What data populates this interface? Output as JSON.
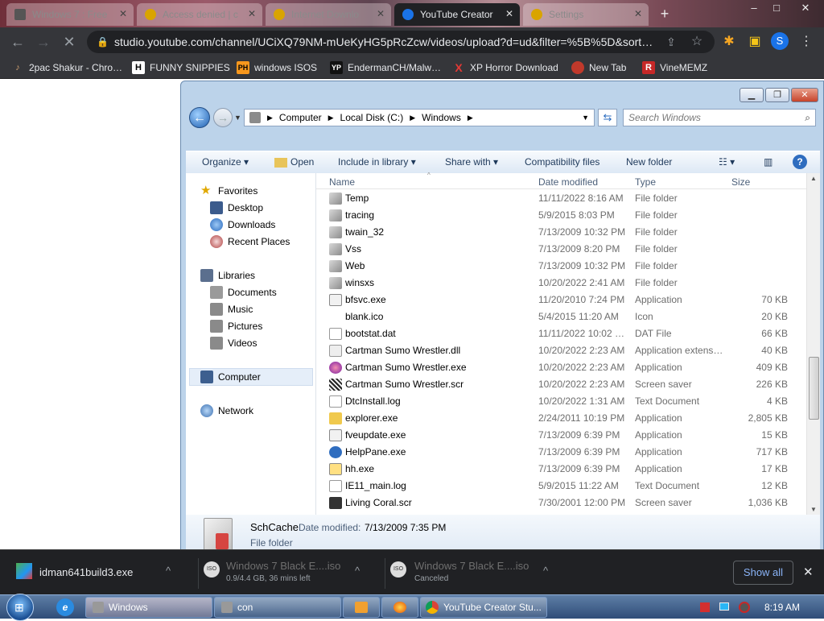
{
  "browser": {
    "tabs": [
      {
        "title": "Windows 7 : Free",
        "icon_color": "#6b6b6b"
      },
      {
        "title": "Access denied | c",
        "icon_color": "#f4b400"
      },
      {
        "title": "Internet Downlo",
        "icon_color": "#f4b400"
      },
      {
        "title": "YouTube Creator",
        "icon_color": "#1a73e8"
      },
      {
        "title": "Settings",
        "icon_color": "#f4b400"
      }
    ],
    "new_tab": "+",
    "window_controls": [
      "–",
      "□",
      "✕"
    ],
    "url": "studio.youtube.com/channel/UCiXQ79NM-mUeKyHG5pRcZcw/videos/upload?d=ud&filter=%5B%5D&sort…",
    "profile_initial": "S",
    "bookmarks": [
      {
        "label": "2pac Shakur - Chro…",
        "icon": "guitar-icon"
      },
      {
        "label": "FUNNY SNIPPIES",
        "icon": "H"
      },
      {
        "label": "windows ISOS",
        "icon": "PH"
      },
      {
        "label": "EndermanCH/Malw…",
        "icon": "YP"
      },
      {
        "label": "XP Horror Download",
        "icon": "X"
      },
      {
        "label": "New Tab",
        "icon": "globe-icon"
      },
      {
        "label": "VineMEMZ",
        "icon": "R"
      }
    ]
  },
  "explorer": {
    "breadcrumb": [
      "Computer",
      "Local Disk (C:)",
      "Windows"
    ],
    "search_placeholder": "Search Windows",
    "toolbar": {
      "organize": "Organize",
      "open": "Open",
      "include": "Include in library",
      "share": "Share with",
      "compat": "Compatibility files",
      "new_folder": "New folder"
    },
    "nav": {
      "favorites": "Favorites",
      "desktop": "Desktop",
      "downloads": "Downloads",
      "recent": "Recent Places",
      "libraries": "Libraries",
      "documents": "Documents",
      "music": "Music",
      "pictures": "Pictures",
      "videos": "Videos",
      "computer": "Computer",
      "network": "Network"
    },
    "columns": {
      "name": "Name",
      "date": "Date modified",
      "type": "Type",
      "size": "Size"
    },
    "files": [
      {
        "name": "Temp",
        "date": "11/11/2022 8:16 AM",
        "type": "File folder",
        "size": "",
        "kind": "folder"
      },
      {
        "name": "tracing",
        "date": "5/9/2015 8:03 PM",
        "type": "File folder",
        "size": "",
        "kind": "folder"
      },
      {
        "name": "twain_32",
        "date": "7/13/2009 10:32 PM",
        "type": "File folder",
        "size": "",
        "kind": "folder"
      },
      {
        "name": "Vss",
        "date": "7/13/2009 8:20 PM",
        "type": "File folder",
        "size": "",
        "kind": "folder"
      },
      {
        "name": "Web",
        "date": "7/13/2009 10:32 PM",
        "type": "File folder",
        "size": "",
        "kind": "folder"
      },
      {
        "name": "winsxs",
        "date": "10/20/2022 2:41 AM",
        "type": "File folder",
        "size": "",
        "kind": "folder"
      },
      {
        "name": "bfsvc.exe",
        "date": "11/20/2010 7:24 PM",
        "type": "Application",
        "size": "70 KB",
        "kind": "app"
      },
      {
        "name": "blank.ico",
        "date": "5/4/2015 11:20 AM",
        "type": "Icon",
        "size": "20 KB",
        "kind": "blank"
      },
      {
        "name": "bootstat.dat",
        "date": "11/11/2022 10:02 …",
        "type": "DAT File",
        "size": "66 KB",
        "kind": "file"
      },
      {
        "name": "Cartman Sumo Wrestler.dll",
        "date": "10/20/2022 2:23 AM",
        "type": "Application extens…",
        "size": "40 KB",
        "kind": "dll"
      },
      {
        "name": "Cartman Sumo Wrestler.exe",
        "date": "10/20/2022 2:23 AM",
        "type": "Application",
        "size": "409 KB",
        "kind": "exe"
      },
      {
        "name": "Cartman Sumo Wrestler.scr",
        "date": "10/20/2022 2:23 AM",
        "type": "Screen saver",
        "size": "226 KB",
        "kind": "scr"
      },
      {
        "name": "DtcInstall.log",
        "date": "10/20/2022 1:31 AM",
        "type": "Text Document",
        "size": "4 KB",
        "kind": "text"
      },
      {
        "name": "explorer.exe",
        "date": "2/24/2011 10:19 PM",
        "type": "Application",
        "size": "2,805 KB",
        "kind": "explorer"
      },
      {
        "name": "fveupdate.exe",
        "date": "7/13/2009 6:39 PM",
        "type": "Application",
        "size": "15 KB",
        "kind": "app"
      },
      {
        "name": "HelpPane.exe",
        "date": "7/13/2009 6:39 PM",
        "type": "Application",
        "size": "717 KB",
        "kind": "help"
      },
      {
        "name": "hh.exe",
        "date": "7/13/2009 6:39 PM",
        "type": "Application",
        "size": "17 KB",
        "kind": "hh"
      },
      {
        "name": "IE11_main.log",
        "date": "5/9/2015 11:22 AM",
        "type": "Text Document",
        "size": "12 KB",
        "kind": "text"
      },
      {
        "name": "Living Coral.scr",
        "date": "7/30/2001 12:00 PM",
        "type": "Screen saver",
        "size": "1,036 KB",
        "kind": "scr2"
      }
    ],
    "details": {
      "name": "SchCache",
      "date_label": "Date modified:",
      "date": "7/13/2009 7:35 PM",
      "type": "File folder"
    }
  },
  "downloads": [
    {
      "name": "idman641build3.exe",
      "status": ""
    },
    {
      "name": "Windows 7 Black E....iso",
      "status": "0.9/4.4 GB, 36 mins left"
    },
    {
      "name": "Windows 7 Black E....iso",
      "status": "Canceled"
    }
  ],
  "show_all": "Show all",
  "taskbar": {
    "items": [
      "Windows",
      "con",
      "",
      "",
      "YouTube Creator Stu..."
    ],
    "clock": "8:19 AM"
  }
}
